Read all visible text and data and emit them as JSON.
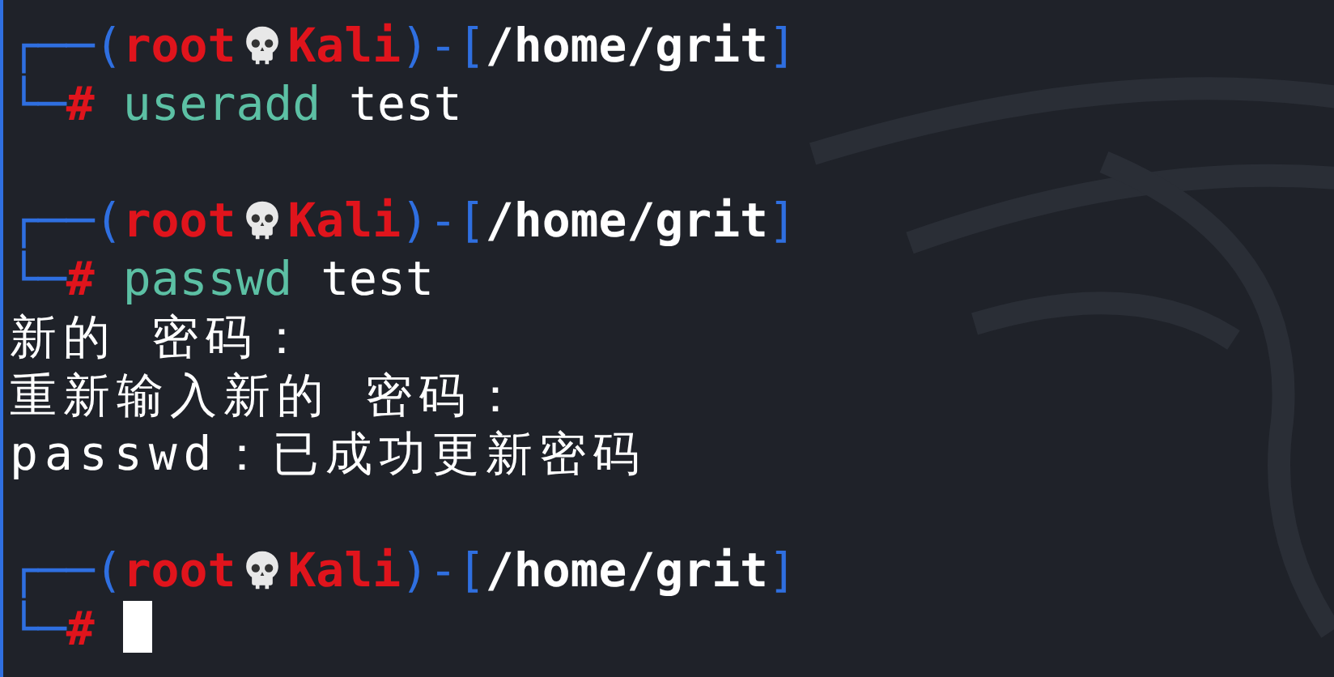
{
  "terminal": {
    "lines": [
      {
        "kind": "prompt",
        "open": "┌──(",
        "user": "root",
        "host": "Kali",
        "middle": ")-[",
        "path": "/home/grit",
        "close": "]",
        "corner": "└─",
        "symbol": "#",
        "command": "useradd",
        "args": "test",
        "cursor": false
      },
      {
        "kind": "prompt",
        "open": "┌──(",
        "user": "root",
        "host": "Kali",
        "middle": ")-[",
        "path": "/home/grit",
        "close": "]",
        "corner": "└─",
        "symbol": "#",
        "command": "passwd",
        "args": "test",
        "cursor": false
      },
      {
        "kind": "output",
        "text": "新的 密码："
      },
      {
        "kind": "output",
        "text": "重新输入新的 密码："
      },
      {
        "kind": "output",
        "text": "passwd：已成功更新密码"
      },
      {
        "kind": "prompt",
        "open": "┌──(",
        "user": "root",
        "host": "Kali",
        "middle": ")-[",
        "path": "/home/grit",
        "close": "]",
        "corner": "└─",
        "symbol": "#",
        "cursor": true
      }
    ]
  }
}
